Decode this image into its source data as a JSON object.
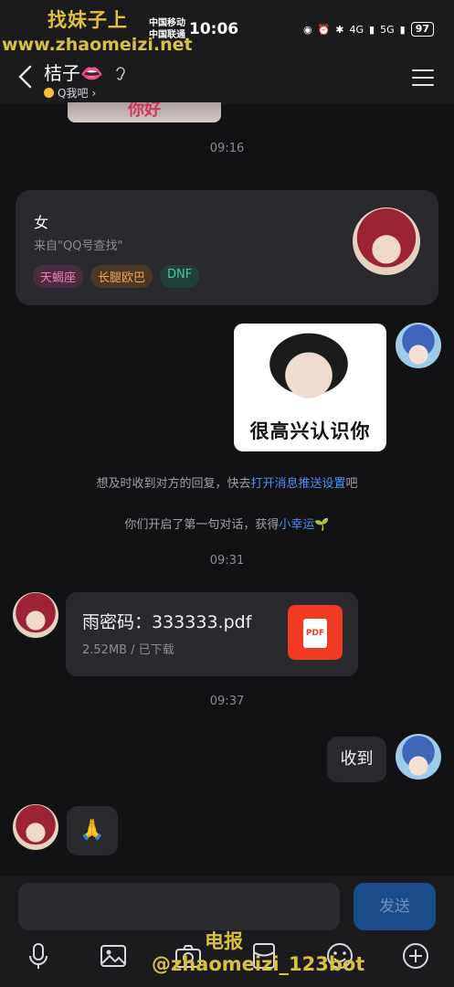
{
  "watermark": {
    "top": "找妹子上",
    "url": "www.zhaomeizi.net",
    "bottom_line1": "电报",
    "bottom_line2": "@zhaomeizi_123bot"
  },
  "status_bar": {
    "carrier1": "中国移动",
    "carrier2": "中国联通",
    "time": "10:06",
    "net1": "4G",
    "net2": "5G",
    "battery": "97"
  },
  "header": {
    "title": "桔子👄",
    "subtitle": "Q我吧",
    "sub_arrow": "›"
  },
  "previous_image": {
    "text": "你好"
  },
  "timestamps": [
    "09:16",
    "09:31",
    "09:37"
  ],
  "profile_card": {
    "gender": "女",
    "source": "来自\"QQ号查找\"",
    "tags": [
      "天蝎座",
      "长腿欧巴",
      "DNF"
    ]
  },
  "sticker": {
    "caption": "很高兴认识你"
  },
  "system_notes": {
    "push_prefix": "想及时收到对方的回复，快去",
    "push_link": "打开消息推送设置",
    "push_suffix": "吧",
    "first_prefix": "你们开启了第一句对话，获得",
    "first_link": "小幸运",
    "first_emoji": "🌱"
  },
  "file_message": {
    "name": "雨密码：333333.pdf",
    "meta": "2.52MB / 已下载",
    "icon_label": "PDF"
  },
  "sent_text": "收到",
  "reply_emoji": "🙏",
  "input": {
    "send_label": "发送"
  },
  "colors": {
    "accent": "#4d8ff5",
    "pdf": "#f03a24",
    "send_bg": "#1a4c8a"
  }
}
